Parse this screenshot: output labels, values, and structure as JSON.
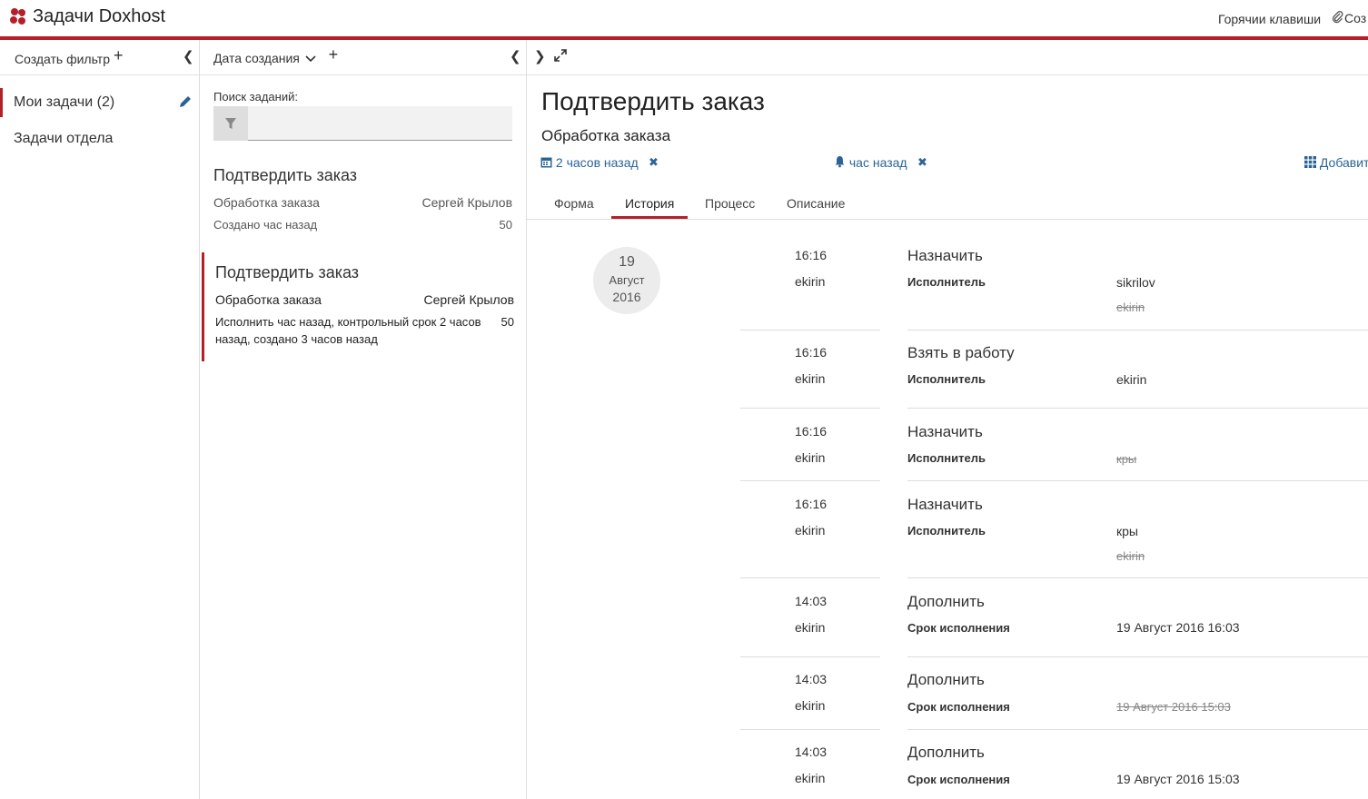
{
  "app": {
    "title": "Задачи Doxhost",
    "hotkeys": "Горячии клавиши",
    "create_label": "Соз"
  },
  "filters": {
    "create_label": "Создать фильтр",
    "items": [
      {
        "label": "Мои задачи (2)"
      },
      {
        "label": "Задачи отдела"
      }
    ]
  },
  "list": {
    "sort_label": "Дата создания",
    "search_label": "Поиск заданий:",
    "search_placeholder": "",
    "tasks": [
      {
        "title": "Подтвердить заказ",
        "process": "Обработка заказа",
        "assignee": "Сергей Крылов",
        "info": "Создано час назад",
        "priority": "50"
      },
      {
        "title": "Подтвердить заказ",
        "process": "Обработка заказа",
        "assignee": "Сергей Крылов",
        "info_line1": "Исполнить час назад, контрольный срок 2 часов",
        "info_line2": "назад, создано 3 часов назад",
        "priority": "50"
      }
    ]
  },
  "detail": {
    "title": "Подтвердить заказ",
    "process": "Обработка заказа",
    "created": "2 часов назад",
    "reminder": "час назад",
    "add_label": "Добавит",
    "tabs": [
      {
        "label": "Форма"
      },
      {
        "label": "История"
      },
      {
        "label": "Процесс"
      },
      {
        "label": "Описание"
      }
    ],
    "history": {
      "date_day": "19",
      "date_month": "Август",
      "date_year": "2016",
      "entries": [
        {
          "time": "16:16",
          "user": "ekirin",
          "action": "Назначить",
          "field": "Исполнитель",
          "new": "sikrilov",
          "old": "ekirin"
        },
        {
          "time": "16:16",
          "user": "ekirin",
          "action": "Взять в работу",
          "field": "Исполнитель",
          "new": "ekirin"
        },
        {
          "time": "16:16",
          "user": "ekirin",
          "action": "Назначить",
          "field": "Исполнитель",
          "old": "кры"
        },
        {
          "time": "16:16",
          "user": "ekirin",
          "action": "Назначить",
          "field": "Исполнитель",
          "new": "кры",
          "old": "ekirin"
        },
        {
          "time": "14:03",
          "user": "ekirin",
          "action": "Дополнить",
          "field": "Срок исполнения",
          "new": "19 Август 2016 16:03"
        },
        {
          "time": "14:03",
          "user": "ekirin",
          "action": "Дополнить",
          "field": "Срок исполнения",
          "old": "19 Август 2016 15:03"
        },
        {
          "time": "14:03",
          "user": "ekirin",
          "action": "Дополнить",
          "field": "Срок исполнения",
          "new": "19 Август 2016 15:03"
        }
      ]
    }
  }
}
